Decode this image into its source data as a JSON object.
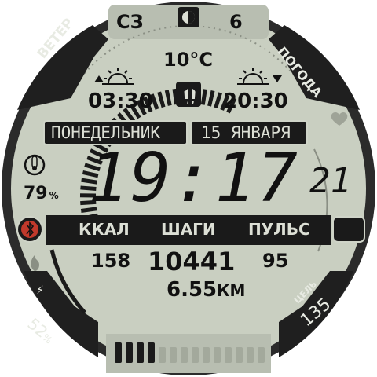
{
  "corners": {
    "top_left": "ВЕТЕР",
    "top_right": "ПОГОДА",
    "bottom_left_value": "52",
    "bottom_left_unit": "%",
    "bottom_right_label": "ЦЕЛЬ",
    "bottom_right_value": "135"
  },
  "top": {
    "wind_dir": "СЗ",
    "moon_icon": "moon-phase-icon",
    "wind_speed": "6",
    "temperature": "10°C",
    "sunrise": "03:30",
    "sunset": "20:30",
    "weather_icon": "rain-cloud-icon"
  },
  "date": {
    "weekday": "ПОНЕДЕЛЬНИК",
    "day_month": "15 ЯНВАРЯ"
  },
  "time": {
    "hours_minutes": "19:17",
    "seconds": "21"
  },
  "left": {
    "humidity_value": "79",
    "humidity_unit": "%"
  },
  "stats": {
    "labels": [
      "ККАЛ",
      "ШАГИ",
      "ПУЛЬС"
    ],
    "kcal": "158",
    "steps": "10441",
    "pulse": "95",
    "distance_value": "6.55",
    "distance_unit": "КМ"
  },
  "colors": {
    "lcd": "#c9cfc1",
    "rim": "#2a2a2a",
    "dark": "#1a1a1a",
    "text": "#111111",
    "accent_red": "#c0392b"
  }
}
